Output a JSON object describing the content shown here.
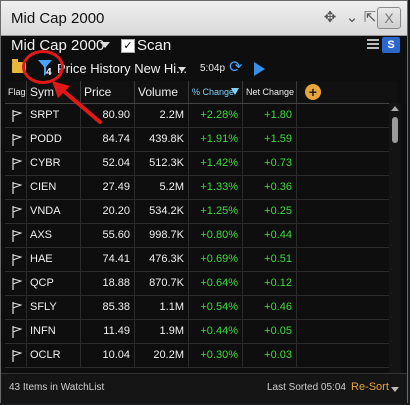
{
  "window": {
    "title": "Mid Cap 2000"
  },
  "toolbar": {
    "watchlist_name": "Mid Cap 2000",
    "scan_label": "Scan",
    "scan_checked": true,
    "s_badge": "S",
    "filter_count": "4",
    "filter_label": "Price History New Hi...",
    "time": "5:04p"
  },
  "columns": {
    "flag": "Flag",
    "sym": "Sym",
    "price": "Price",
    "volume": "Volume",
    "pct_change": "% Change",
    "net_change": "Net Change",
    "add": "+"
  },
  "rows": [
    {
      "sym": "SRPT",
      "price": "80.90",
      "volume": "2.2M",
      "pct": "+2.28%",
      "net": "+1.80"
    },
    {
      "sym": "PODD",
      "price": "84.74",
      "volume": "439.8K",
      "pct": "+1.91%",
      "net": "+1.59"
    },
    {
      "sym": "CYBR",
      "price": "52.04",
      "volume": "512.3K",
      "pct": "+1.42%",
      "net": "+0.73"
    },
    {
      "sym": "CIEN",
      "price": "27.49",
      "volume": "5.2M",
      "pct": "+1.33%",
      "net": "+0.36"
    },
    {
      "sym": "VNDA",
      "price": "20.20",
      "volume": "534.2K",
      "pct": "+1.25%",
      "net": "+0.25"
    },
    {
      "sym": "AXS",
      "price": "55.60",
      "volume": "998.7K",
      "pct": "+0.80%",
      "net": "+0.44"
    },
    {
      "sym": "HAE",
      "price": "74.41",
      "volume": "476.3K",
      "pct": "+0.69%",
      "net": "+0.51"
    },
    {
      "sym": "QCP",
      "price": "18.88",
      "volume": "870.7K",
      "pct": "+0.64%",
      "net": "+0.12"
    },
    {
      "sym": "SFLY",
      "price": "85.38",
      "volume": "1.1M",
      "pct": "+0.54%",
      "net": "+0.46"
    },
    {
      "sym": "INFN",
      "price": "11.49",
      "volume": "1.9M",
      "pct": "+0.44%",
      "net": "+0.05"
    },
    {
      "sym": "OCLR",
      "price": "10.04",
      "volume": "20.2M",
      "pct": "+0.30%",
      "net": "+0.03"
    }
  ],
  "status": {
    "items_count": "43 Items in WatchList",
    "last_sorted": "Last Sorted 05:04",
    "resort": "Re-Sort"
  },
  "colors": {
    "positive": "#3fd93f",
    "accent": "#e8a33a",
    "annotation": "#e01818"
  }
}
